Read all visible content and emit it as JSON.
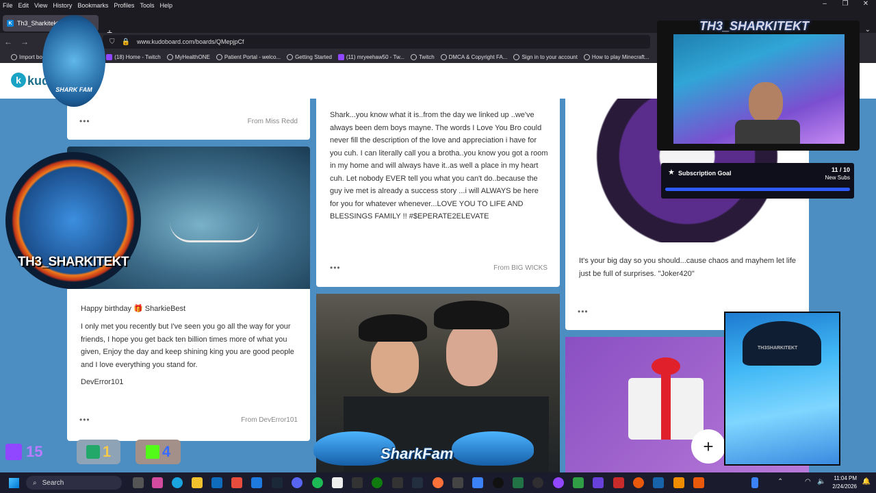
{
  "menu": [
    "File",
    "Edit",
    "View",
    "History",
    "Bookmarks",
    "Profiles",
    "Tools",
    "Help"
  ],
  "tab": {
    "title": "Th3_Sharkitekt"
  },
  "url": "www.kudoboard.com/boards/QMepjpCf",
  "bookmarks": [
    "Import boo",
    "(18) Home - Twitch",
    "MyHealthONE",
    "Patient Portal - welco...",
    "Getting Started",
    "(11) mryeehaw50 - Tw...",
    "Twitch",
    "DMCA & Copyright FA...",
    "Sign in to your account",
    "How to play Minecraft..."
  ],
  "site": {
    "logo_text": "kudo"
  },
  "cards": {
    "card1": {
      "from": "From Miss Redd"
    },
    "card2": {
      "text": "Shark...you know what it is..from the day we linked up ..we've always been dem boys mayne. The words I Love You Bro could never fill the description of the love and appreciation i have for you cuh. I can literally call you a brotha..you know you got a room in my home and will always have it..as well a place in my heart cuh. Let nobody EVER tell you what you can't do..because the guy ive met is already a success story ...i will ALWAYS be here for you for whatever whenever...LOVE YOU TO LIFE AND BLESSINGS FAMILY !! #$EPERATE2ELEVATE",
      "from": "From BIG WICKS"
    },
    "card3": {
      "text": "It's your big day so you should...cause chaos and mayhem let life just be full of surprises. \"Joker420\""
    },
    "card4": {
      "greeting": "Happy birthday 🎁 SharkieBest",
      "text": "I only met you recently but I've seen you go all the way for your friends, I hope you get back ten billion times more of what you given, Enjoy the day and keep shining king you are good people and I love everything you stand for.",
      "signature": "DevError101",
      "from": "From DevError101"
    }
  },
  "overlay": {
    "channel_banner": "TH3_SHARKITEKT",
    "badge_text": "TH3_SHARKITEKT",
    "small_logo": "SHARK FAM",
    "subscription_goal": {
      "label": "Subscription Goal",
      "count": "11 / 10",
      "unit": "New Subs",
      "progress": 1.0
    },
    "sharkfam": "SharkFam",
    "counters": [
      "15",
      "1",
      "4"
    ],
    "cam_hat": "TH3SHARKITEKT"
  },
  "taskbar": {
    "search": "Search",
    "time": "11:04 PM",
    "date": "2/24/2026"
  },
  "colors": {
    "page_bg": "#4d8ec2",
    "accent": "#1ba3c6",
    "twitch": "#9146ff"
  }
}
